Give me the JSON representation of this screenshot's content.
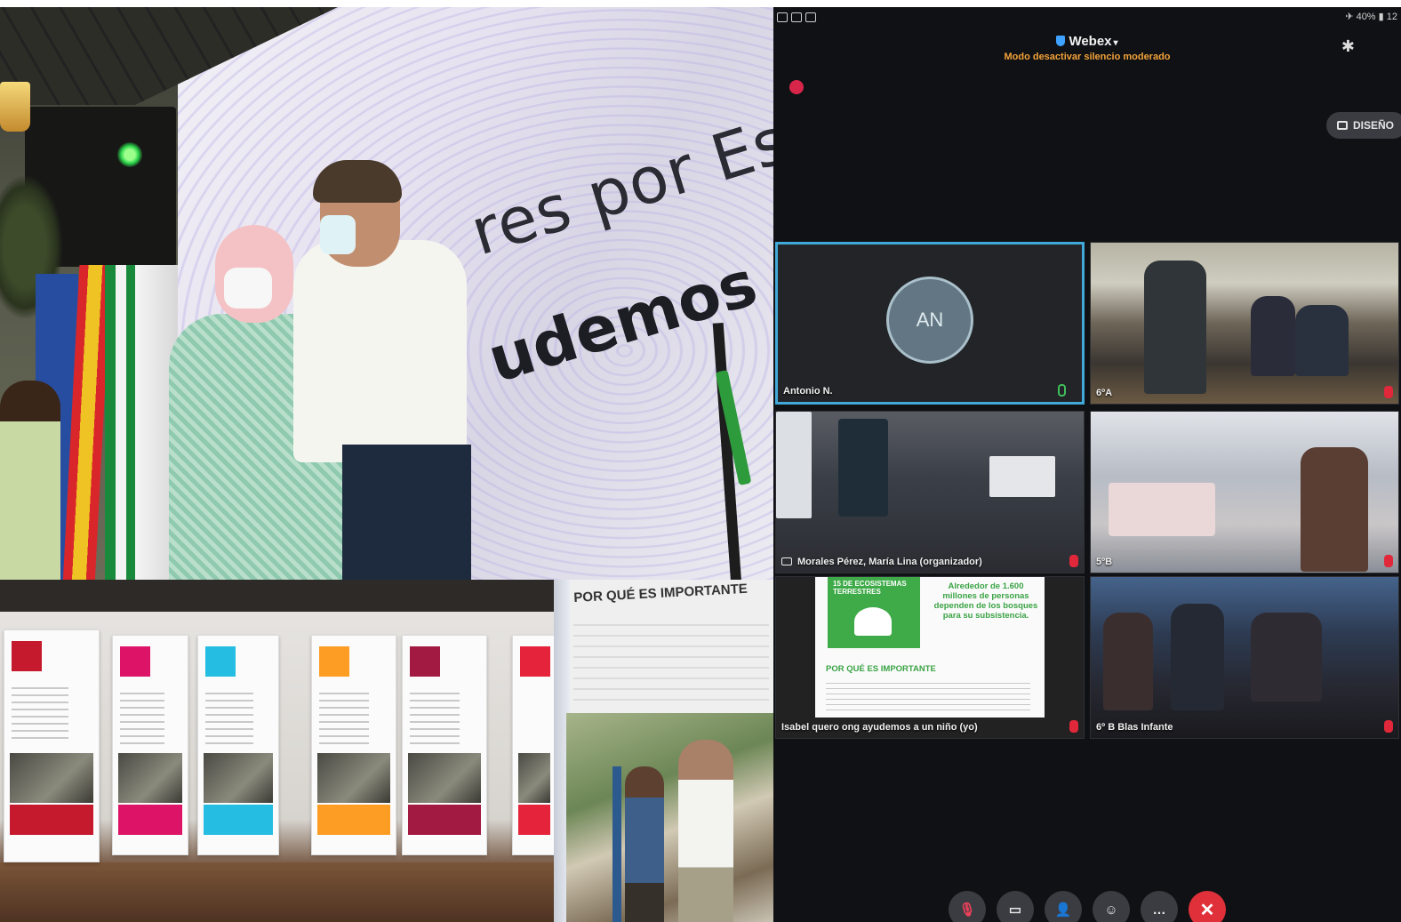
{
  "stage_photo": {
    "screen_line_1": "res por Esp",
    "screen_line_2": "udemos c"
  },
  "poster_photo": {
    "title": "POR QUÉ ES IMPORTANTE"
  },
  "webex": {
    "status_battery": "✈ 40% ▮ 12",
    "app_name": "Webex",
    "mode_text": "Modo desactivar silencio moderado",
    "layout_button": "DISEÑO",
    "accent_color": "#40a9d9",
    "participants": [
      {
        "name": "Antonio N.",
        "avatar_initials": "AN",
        "muted": false,
        "active": true
      },
      {
        "name": "6ºA",
        "muted": true
      },
      {
        "name": "Morales Pérez, María Lina (organizador)",
        "muted": true
      },
      {
        "name": "5ºB",
        "muted": true
      },
      {
        "name": "Isabel quero ong ayudemos a un niño (yo)",
        "muted": true
      },
      {
        "name": "6º B Blas Infante",
        "muted": true
      }
    ],
    "shared_slide": {
      "sdg_label": "15 DE ECOSISTEMAS TERRESTRES",
      "quote": "Alrededor de 1.600 millones de personas dependen de los bosques para su subsistencia.",
      "heading": "POR QUÉ ES IMPORTANTE"
    },
    "controls": [
      "mute-icon",
      "camera-icon",
      "participants-icon",
      "reactions-icon",
      "more-icon",
      "end-call-icon"
    ]
  }
}
